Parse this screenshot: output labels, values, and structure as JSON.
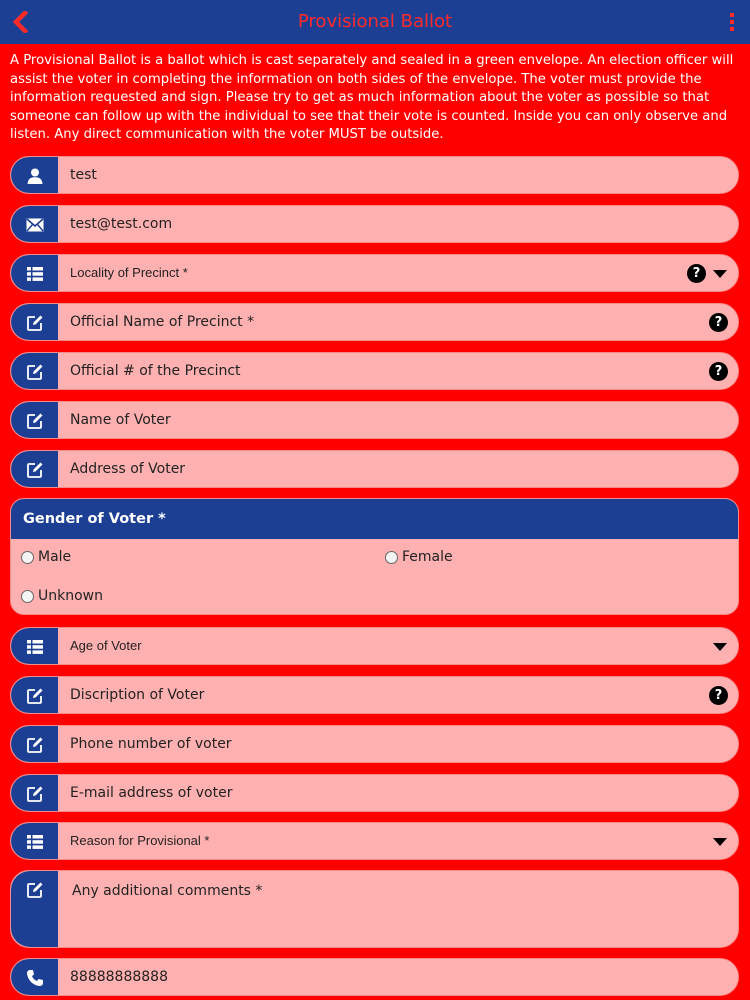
{
  "header": {
    "title": "Provisional Ballot",
    "back_icon": "chevron-left-icon",
    "menu_icon": "more-vertical-icon"
  },
  "intro_text": "A Provisional Ballot is a ballot which is cast separately and sealed in a green envelope. An election officer will assist the voter in completing the information on both sides of the envelope. The voter must provide the information requested and sign. Please try to get as much information about the voter as possible so that someone can follow up with the individual to see that their vote is counted. Inside you can only observe and listen. Any direct communication with the voter MUST be outside.",
  "form": {
    "name": {
      "value": "test",
      "icon": "user-icon"
    },
    "email": {
      "value": "test@test.com",
      "icon": "envelope-icon"
    },
    "locality": {
      "label": "Locality of Precinct *",
      "icon": "list-icon"
    },
    "precinct_name": {
      "placeholder": "Official Name of Precinct *",
      "icon": "edit-icon"
    },
    "precinct_number": {
      "placeholder": "Official # of the Precinct",
      "icon": "edit-icon"
    },
    "voter_name": {
      "placeholder": "Name of Voter",
      "icon": "edit-icon"
    },
    "voter_address": {
      "placeholder": "Address of Voter",
      "icon": "edit-icon"
    },
    "gender": {
      "label": "Gender of Voter *",
      "options": [
        "Male",
        "Female",
        "Unknown"
      ]
    },
    "age": {
      "label": "Age of Voter",
      "icon": "list-icon"
    },
    "description": {
      "placeholder": "Discription of Voter",
      "icon": "edit-icon"
    },
    "phone_voter": {
      "placeholder": "Phone number of voter",
      "icon": "edit-icon"
    },
    "email_voter": {
      "placeholder": "E-mail address of voter",
      "icon": "edit-icon"
    },
    "reason": {
      "label": "Reason for Provisional *",
      "icon": "list-icon"
    },
    "comments": {
      "placeholder": "Any additional comments *",
      "icon": "edit-icon"
    },
    "phone": {
      "value": "88888888888",
      "icon": "phone-icon"
    }
  },
  "colors": {
    "background": "#ff0000",
    "header": "#1c3f94",
    "field": "#ffb0b0",
    "title": "#ff2a2a"
  }
}
